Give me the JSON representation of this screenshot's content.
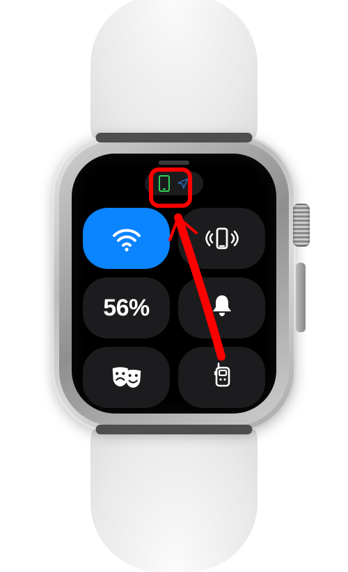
{
  "status": {
    "phone_connection_icon": "phone-connected",
    "location_icon": "location-arrow",
    "location_color": "#2f6fbf"
  },
  "tiles": {
    "wifi": {
      "icon": "wifi",
      "active": true
    },
    "ping": {
      "icon": "ping-phone",
      "active": false
    },
    "battery": {
      "label": "56%",
      "active": false
    },
    "silent": {
      "icon": "bell",
      "active": false
    },
    "theater": {
      "icon": "theater-masks",
      "active": false
    },
    "walkie": {
      "icon": "walkie-talkie",
      "active": false
    }
  },
  "annotation": {
    "target": "phone-connection-status",
    "highlight_color": "#ff0000"
  }
}
